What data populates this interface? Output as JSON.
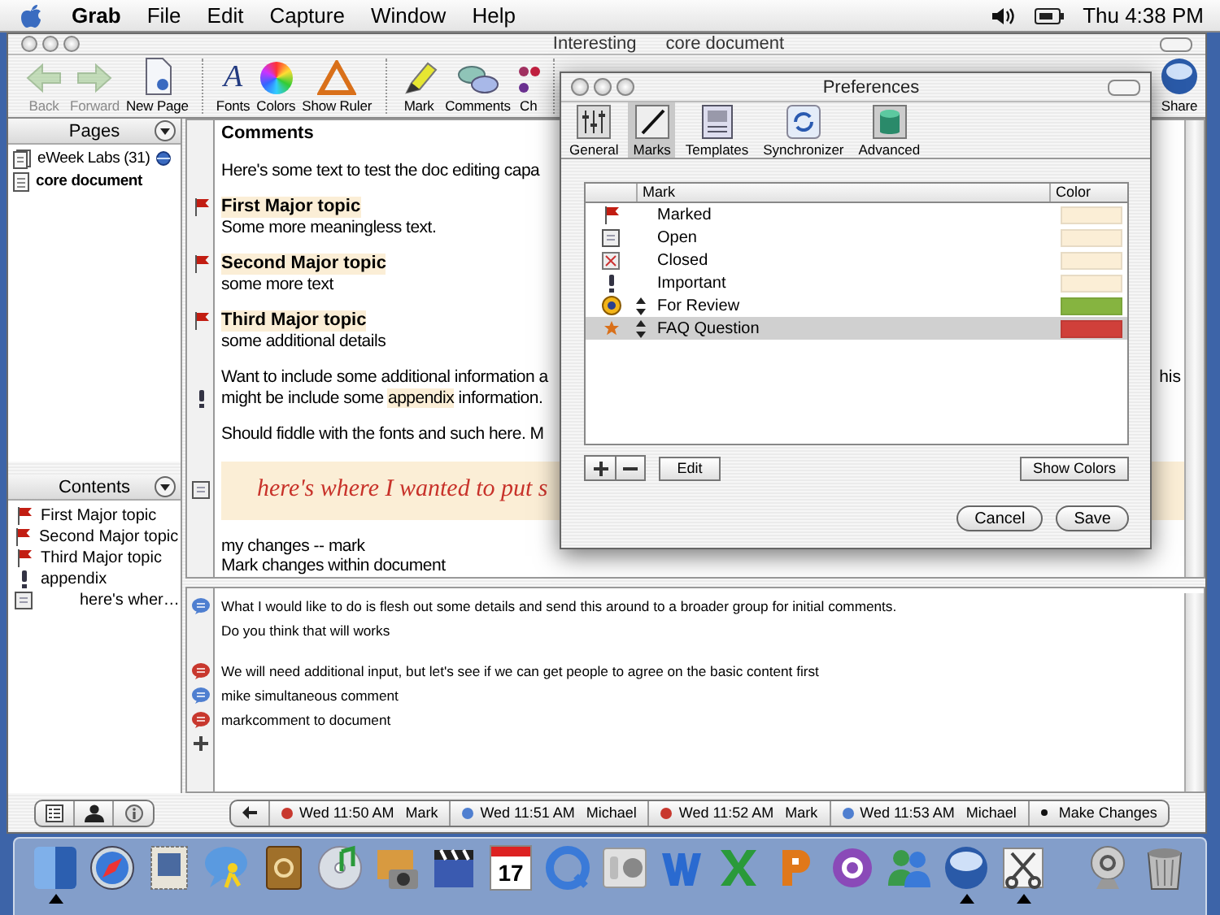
{
  "menubar": {
    "app": "Grab",
    "menus": [
      "File",
      "Edit",
      "Capture",
      "Window",
      "Help"
    ],
    "clock": "Thu 4:38 PM"
  },
  "window": {
    "title": "Interesting",
    "document_title": "core document",
    "toolbar": [
      [
        {
          "label": "Back",
          "kind": "back",
          "disabled": true
        },
        {
          "label": "Forward",
          "kind": "forward",
          "disabled": true
        },
        {
          "label": "New Page",
          "kind": "page",
          "disabled": false
        }
      ],
      [
        {
          "label": "Fonts",
          "kind": "glyph",
          "glyph": "A",
          "disabled": false
        },
        {
          "label": "Colors",
          "kind": "wheel",
          "disabled": false
        },
        {
          "label": "Show Ruler",
          "kind": "ruler",
          "disabled": false
        }
      ],
      [
        {
          "label": "Mark",
          "kind": "highlighter",
          "disabled": false
        },
        {
          "label": "Comments",
          "kind": "bubbles",
          "disabled": false
        },
        {
          "label": "Ch",
          "kind": "pins",
          "disabled": false
        }
      ]
    ],
    "share": "Share"
  },
  "pages": {
    "title": "Pages",
    "items": [
      {
        "label": "eWeek Labs (31)",
        "kind": "stack",
        "selected": false,
        "synced": true
      },
      {
        "label": "core document",
        "kind": "page",
        "selected": true,
        "synced": false
      }
    ]
  },
  "contents": {
    "title": "Contents",
    "items": [
      {
        "label": "First Major topic",
        "kind": "flag"
      },
      {
        "label": "Second Major topic",
        "kind": "flag"
      },
      {
        "label": "Third Major topic",
        "kind": "flag"
      },
      {
        "label": "appendix",
        "kind": "important",
        "children": [
          {
            "label": "here's wher…",
            "kind": "open"
          }
        ]
      }
    ]
  },
  "document": {
    "blocks": [
      {
        "lines": [
          {
            "kind": "heading",
            "text": "Comments"
          }
        ]
      },
      {
        "lines": [
          {
            "kind": "plain",
            "text": "Here's some text to test the doc editing capa"
          }
        ]
      },
      {
        "lines": [
          {
            "kind": "topic",
            "text": "First Major topic"
          },
          {
            "kind": "plain",
            "text": "Some more meaningless text."
          }
        ]
      },
      {
        "lines": [
          {
            "kind": "topic",
            "text": "Second Major topic"
          },
          {
            "kind": "plain",
            "text": "some more text"
          }
        ]
      },
      {
        "lines": [
          {
            "kind": "topic",
            "text": "Third Major topic"
          },
          {
            "kind": "plain",
            "text": "some additional details"
          }
        ]
      },
      {
        "lines": [
          {
            "kind": "plain",
            "text": "Want to include some additional information a",
            "text_right": "his"
          },
          {
            "kind": "important",
            "segments": [
              {
                "text": "might be include some ",
                "highlight": false
              },
              {
                "text": "appendix",
                "highlight": true
              },
              {
                "text": " information.",
                "highlight": false
              }
            ]
          }
        ]
      },
      {
        "lines": [
          {
            "kind": "plain",
            "text": "Should fiddle with the fonts and such here. M"
          }
        ]
      },
      {
        "lines": [
          {
            "kind": "handwriting",
            "text": "here's where I wanted to put s"
          }
        ]
      },
      {
        "lines": [
          {
            "kind": "plain",
            "text": "my changes -- mark"
          },
          {
            "kind": "plain",
            "text": "Mark changes within document"
          }
        ]
      }
    ]
  },
  "comments": [
    [
      {
        "text": "What I would like to do is flesh out some details and send this around to a broader group for initial comments.",
        "color": "#4f7fd0"
      },
      {
        "text": "Do you think that will works"
      }
    ],
    [
      {
        "text": "We will need additional input, but let's see if we can get people to agree on the basic content first",
        "color": "#c8382e"
      },
      {
        "text": "mike simultaneous comment",
        "color": "#4f7fd0"
      },
      {
        "text": "markcomment to document",
        "color": "#c8382e"
      }
    ]
  ],
  "timeline": [
    {
      "kind": "comment",
      "time": "Wed 11:50 AM",
      "author": "Mark",
      "color": "#c8382e"
    },
    {
      "kind": "comment",
      "time": "Wed 11:51 AM",
      "author": "Michael",
      "color": "#4f7fd0"
    },
    {
      "kind": "comment",
      "time": "Wed 11:52 AM",
      "author": "Mark",
      "color": "#c8382e"
    },
    {
      "kind": "comment",
      "time": "Wed 11:53 AM",
      "author": "Michael",
      "color": "#4f7fd0"
    },
    {
      "kind": "change",
      "label": "Make Changes"
    }
  ],
  "preferences": {
    "title": "Preferences",
    "tabs": [
      {
        "label": "General",
        "kind": "sliders",
        "selected": false
      },
      {
        "label": "Marks",
        "kind": "pen",
        "selected": true
      },
      {
        "label": "Templates",
        "kind": "template",
        "selected": false
      },
      {
        "label": "Synchronizer",
        "kind": "sync",
        "selected": false
      },
      {
        "label": "Advanced",
        "kind": "cylinder",
        "selected": false
      }
    ],
    "columns": [
      "Mark",
      "Color"
    ],
    "marks": [
      {
        "kind": "flag",
        "label": "Marked",
        "reorder": false,
        "color": "#fbeed6",
        "selected": false
      },
      {
        "kind": "open",
        "label": "Open",
        "reorder": false,
        "color": "#fbeed6",
        "selected": false
      },
      {
        "kind": "closed",
        "label": "Closed",
        "reorder": false,
        "color": "#fbeed6",
        "selected": false
      },
      {
        "kind": "important",
        "label": "Important",
        "reorder": false,
        "color": "#fbeed6",
        "selected": false
      },
      {
        "kind": "review",
        "label": "For Review",
        "reorder": true,
        "color": "#86b440",
        "selected": false
      },
      {
        "kind": "star",
        "label": "FAQ Question",
        "reorder": true,
        "color": "#d0403a",
        "selected": true
      }
    ],
    "buttons": {
      "edit": "Edit",
      "show_colors": "Show Colors",
      "cancel": "Cancel",
      "save": "Save"
    }
  },
  "dock": [
    {
      "kind": "split-face",
      "running": true
    },
    {
      "kind": "compass",
      "running": false
    },
    {
      "kind": "stamp",
      "running": false
    },
    {
      "kind": "chat",
      "running": false
    },
    {
      "kind": "book",
      "running": false
    },
    {
      "kind": "disc",
      "running": false
    },
    {
      "kind": "camera",
      "running": false
    },
    {
      "kind": "clapper",
      "running": false
    },
    {
      "kind": "calendar",
      "text": "17",
      "running": false
    },
    {
      "kind": "ring",
      "running": false
    },
    {
      "kind": "switch",
      "running": false
    },
    {
      "kind": "app-blue",
      "running": false
    },
    {
      "kind": "app-green",
      "running": false
    },
    {
      "kind": "app-orange",
      "running": false
    },
    {
      "kind": "app-purple",
      "running": false
    },
    {
      "kind": "people",
      "running": false
    },
    {
      "kind": "sphere",
      "running": true
    },
    {
      "kind": "scissors",
      "running": true
    },
    {
      "kind": "divider"
    },
    {
      "kind": "at-stand",
      "running": false
    },
    {
      "kind": "trash",
      "running": false
    }
  ]
}
